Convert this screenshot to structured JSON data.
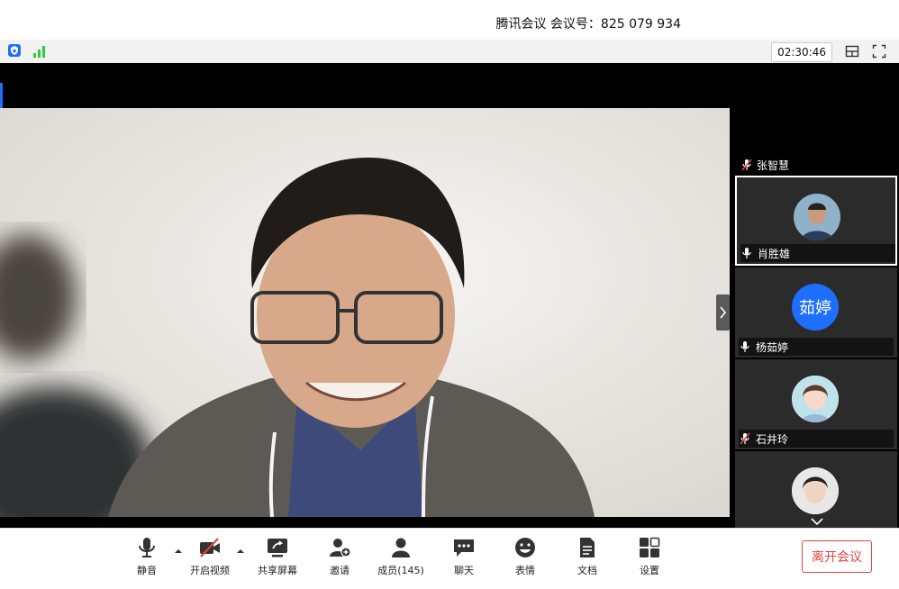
{
  "meeting": {
    "title": "腾讯会议 会议号：825 079 934",
    "timer": "02:30:46"
  },
  "participants_header": {
    "name": "张智慧"
  },
  "participants": [
    {
      "name": "肖胜雄",
      "avatar": "photo",
      "mic": "on"
    },
    {
      "name": "杨茹婷",
      "avatar": "茹婷",
      "mic": "on"
    },
    {
      "name": "石井玲",
      "avatar": "photo",
      "mic": "muted"
    }
  ],
  "toolbar": {
    "mute": "静音",
    "video": "开启视频",
    "share": "共享屏幕",
    "invite": "邀请",
    "members": "成员(145)",
    "chat": "聊天",
    "emoji": "表情",
    "docs": "文档",
    "settings": "设置",
    "leave": "离开会议"
  },
  "colors": {
    "accent": "#1e6fff",
    "leave": "#e0443f",
    "signal": "#2ecc40"
  }
}
